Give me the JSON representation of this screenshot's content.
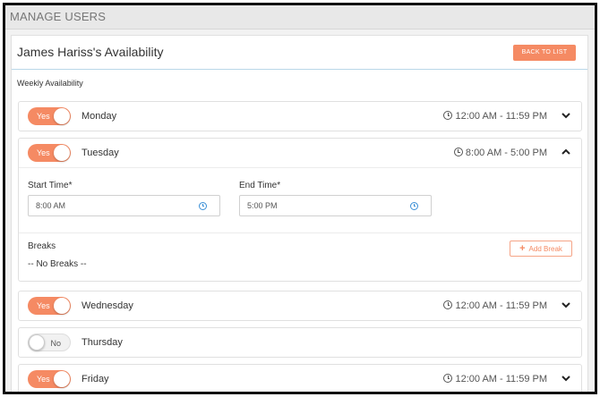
{
  "header": {
    "title": "MANAGE USERS"
  },
  "panel": {
    "title": "James Hariss's Availability",
    "back_label": "BACK TO LIST",
    "section_label": "Weekly Availability"
  },
  "colors": {
    "accent": "#f58a63",
    "border": "#e0e0e0",
    "clock_blue": "#3a8fd6"
  },
  "days": [
    {
      "name": "Monday",
      "enabled": true,
      "toggle_label": "Yes",
      "time_range": "12:00 AM - 11:59 PM",
      "expanded": false,
      "chevron_icon": "chevron-down-icon"
    },
    {
      "name": "Tuesday",
      "enabled": true,
      "toggle_label": "Yes",
      "time_range": "8:00 AM - 5:00 PM",
      "expanded": true,
      "chevron_icon": "chevron-up-icon",
      "start_time_label": "Start Time*",
      "start_time_value": "8:00 AM",
      "end_time_label": "End Time*",
      "end_time_value": "5:00 PM",
      "breaks_label": "Breaks",
      "no_breaks_text": "-- No Breaks --",
      "add_break_label": "Add Break"
    },
    {
      "name": "Wednesday",
      "enabled": true,
      "toggle_label": "Yes",
      "time_range": "12:00 AM - 11:59 PM",
      "expanded": false,
      "chevron_icon": "chevron-down-icon"
    },
    {
      "name": "Thursday",
      "enabled": false,
      "toggle_label": "No",
      "time_range": "",
      "expanded": false
    },
    {
      "name": "Friday",
      "enabled": true,
      "toggle_label": "Yes",
      "time_range": "12:00 AM - 11:59 PM",
      "expanded": false,
      "chevron_icon": "chevron-down-icon"
    }
  ]
}
